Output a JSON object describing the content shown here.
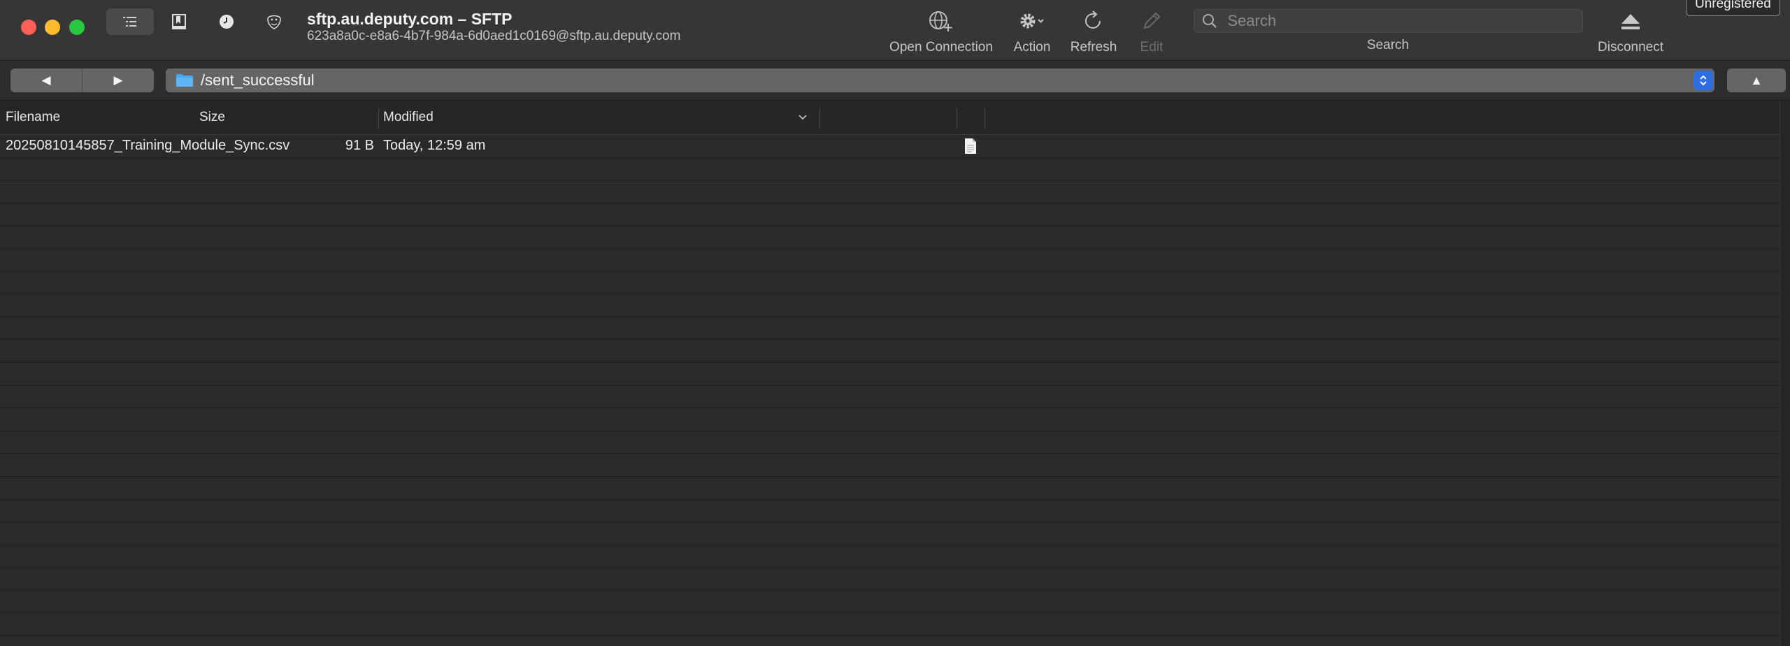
{
  "window": {
    "title": "sftp.au.deputy.com – SFTP",
    "subtitle": "623a8a0c-e8a6-4b7f-984a-6d0aed1c0169@sftp.au.deputy.com"
  },
  "toolbar": {
    "segments": [
      "outline-icon",
      "bookmark-icon",
      "history-icon",
      "bonjour-icon"
    ],
    "open_connection_label": "Open Connection",
    "action_label": "Action",
    "refresh_label": "Refresh",
    "edit_label": "Edit",
    "search_label": "Search",
    "search_placeholder": "Search",
    "disconnect_label": "Disconnect",
    "unregistered_label": "Unregistered"
  },
  "navigation": {
    "back_glyph": "◀",
    "forward_glyph": "▶",
    "path": "/sent_successful",
    "up_glyph": "▲"
  },
  "browser": {
    "columns": {
      "filename": "Filename",
      "size": "Size",
      "modified": "Modified"
    },
    "files": [
      {
        "filename": "20250810145857_Training_Module_Sync.csv",
        "size": "91 B",
        "modified": "Today, 12:59 am",
        "icon": "document-icon"
      }
    ]
  },
  "colors": {
    "toolbar_bg": "#363636",
    "window_bg": "#262626",
    "accent": "#2f6ce0",
    "close": "#fe5f57",
    "minimize": "#febc2e",
    "maximize": "#28c840"
  }
}
